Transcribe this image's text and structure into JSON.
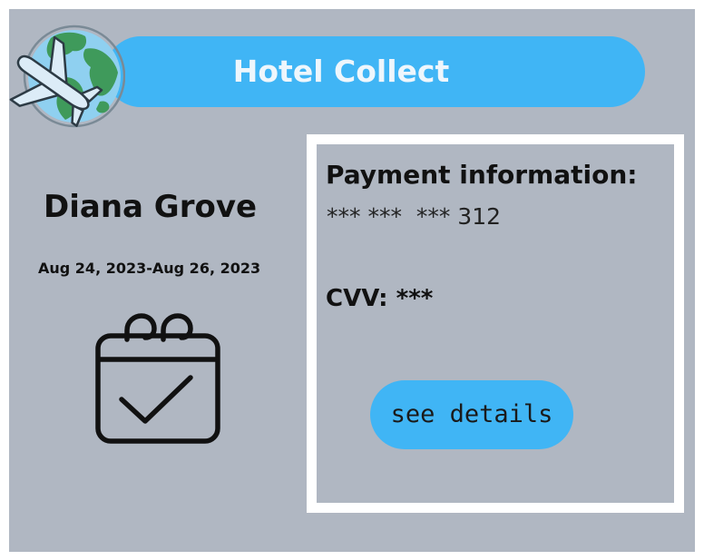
{
  "header": {
    "title": "Hotel Collect",
    "logo_icon": "globe-airplane-icon"
  },
  "booking": {
    "guest_name": "Diana Grove",
    "dates": "Aug 24, 2023-Aug 26, 2023",
    "status_icon": "calendar-check-icon"
  },
  "payment": {
    "title": "Payment information:",
    "card_number": "*** ***  *** 312",
    "cvv": "CVV: ***",
    "details_button": "see details"
  },
  "colors": {
    "background": "#b0b7c2",
    "accent": "#40b5f5",
    "panel_border": "#ffffff"
  }
}
